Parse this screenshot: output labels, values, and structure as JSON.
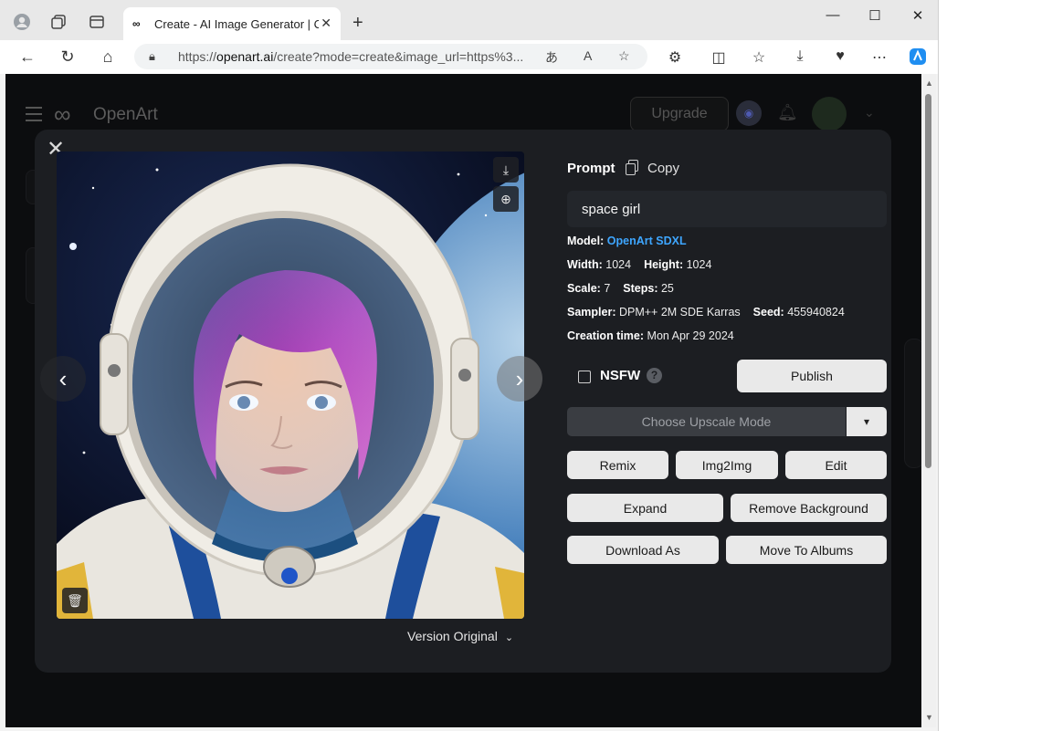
{
  "browser": {
    "tab_title": "Create - AI Image Generator | Cre",
    "tab_favicon": "∞",
    "url_prefix": "https://",
    "url_host": "openart.ai",
    "url_path": "/create?mode=create&image_url=https%3..."
  },
  "site": {
    "logo_text": "OpenArt",
    "upgrade_label": "Upgrade"
  },
  "modal": {
    "prompt_label": "Prompt",
    "copy_label": "Copy",
    "prompt_text": "space girl",
    "model_label": "Model:",
    "model_value": "OpenArt SDXL",
    "width_label": "Width:",
    "width_value": "1024",
    "height_label": "Height:",
    "height_value": "1024",
    "scale_label": "Scale:",
    "scale_value": "7",
    "steps_label": "Steps:",
    "steps_value": "25",
    "sampler_label": "Sampler:",
    "sampler_value": "DPM++ 2M SDE Karras",
    "seed_label": "Seed:",
    "seed_value": "455940824",
    "creation_label": "Creation time:",
    "creation_value": "Mon Apr 29 2024",
    "nsfw_label": "NSFW",
    "help_glyph": "?",
    "publish_label": "Publish",
    "upscale_placeholder": "Choose Upscale Mode",
    "buttons": {
      "remix": "Remix",
      "img2img": "Img2Img",
      "edit": "Edit",
      "expand": "Expand",
      "remove_bg": "Remove Background",
      "download_as": "Download As",
      "move_to_albums": "Move To Albums"
    },
    "version_label": "Version Original"
  },
  "colors": {
    "modal_bg": "#1c1e22",
    "page_bg": "#0c0d0f",
    "link": "#3ea6ff",
    "button_bg": "#e9e9e9"
  }
}
